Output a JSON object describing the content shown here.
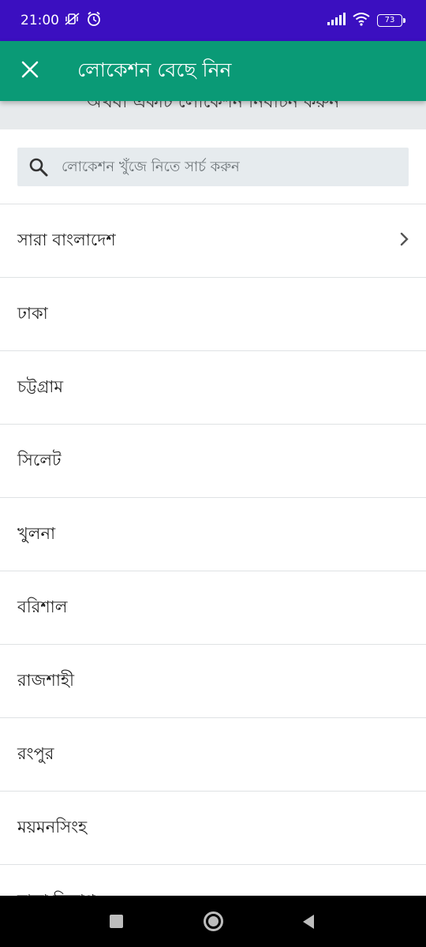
{
  "status": {
    "time": "21:00",
    "battery": "73",
    "icons": [
      "vibrate-mute-icon",
      "alarm-icon",
      "signal-icon",
      "wifi-icon",
      "battery-icon"
    ]
  },
  "header": {
    "title": "লোকেশন বেছে নিন",
    "close_icon": "close-icon",
    "background": "#0a9a76"
  },
  "hint": {
    "text": "অথবা একটি লোকেশন নির্বাচন করুন"
  },
  "search": {
    "placeholder": "লোকেশন খুঁজে নিতে সার্চ করুন",
    "value": ""
  },
  "locations": [
    {
      "label": "সারা বাংলাদেশ",
      "has_chevron": true
    },
    {
      "label": "ঢাকা"
    },
    {
      "label": "চট্টগ্রাম"
    },
    {
      "label": "সিলেট"
    },
    {
      "label": "খুলনা"
    },
    {
      "label": "বরিশাল"
    },
    {
      "label": "রাজশাহী"
    },
    {
      "label": "রংপুর"
    },
    {
      "label": "ময়মনসিংহ"
    },
    {
      "label": "ঢাকা বিভাগ"
    }
  ],
  "navbar": {
    "icons": [
      "recents-icon",
      "home-icon",
      "back-icon"
    ]
  },
  "colors": {
    "status_bar": "#3b0fc0",
    "app_bar": "#0a9a76",
    "search_bg": "#e6ebee"
  }
}
